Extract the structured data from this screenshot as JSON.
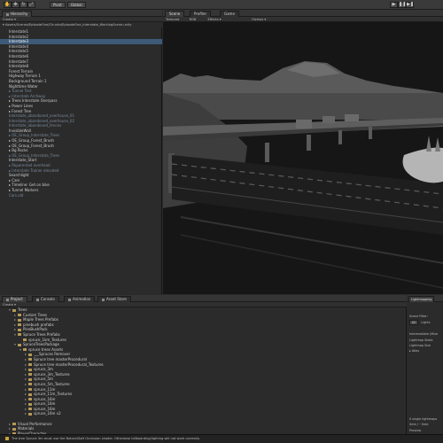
{
  "toolbar": {
    "transform_tools": [
      "✋",
      "✥",
      "↻",
      "⤢"
    ],
    "pivot_label": "Pivot",
    "global_label": "Global",
    "play_controls": [
      "▶",
      "❚❚",
      "▶❚"
    ]
  },
  "hierarchy": {
    "tab_label": "Hierarchy",
    "create_label": "Create ▾",
    "scene_path": "Assets/Scenes/EpisodeOne/Chunks/EpisodeOne_Interstate_WorkingScene.unity",
    "items": [
      {
        "label": "Interstate1",
        "selected": false,
        "dim": false
      },
      {
        "label": "Interstate2",
        "selected": false,
        "dim": false
      },
      {
        "label": "Interstate3",
        "selected": true,
        "dim": false
      },
      {
        "label": "Interstate4",
        "selected": false,
        "dim": false
      },
      {
        "label": "Interstate5",
        "selected": false,
        "dim": false
      },
      {
        "label": "Interstate6",
        "selected": false,
        "dim": false
      },
      {
        "label": "Interstate7",
        "selected": false,
        "dim": false
      },
      {
        "label": "Interstate8",
        "selected": false,
        "dim": false
      },
      {
        "label": "Forest Terrain",
        "selected": false,
        "dim": false
      },
      {
        "label": "Highway Terrain 1",
        "selected": false,
        "dim": false
      },
      {
        "label": "Background Terrain 1",
        "selected": false,
        "dim": false
      },
      {
        "label": "Nighttime Water",
        "selected": false,
        "dim": false
      },
      {
        "label": "▸ Tunnel Test",
        "selected": false,
        "dim": true
      },
      {
        "label": "▸ Interstate Archway",
        "selected": false,
        "dim": true
      },
      {
        "label": "▸ Trees Interstate Overpass",
        "selected": false,
        "dim": false
      },
      {
        "label": "▸ Power Lines",
        "selected": false,
        "dim": false
      },
      {
        "label": "▸ Forest Tree",
        "selected": false,
        "dim": false
      },
      {
        "label": "   Interstate_abandoned_overhouse_01",
        "selected": false,
        "dim": true
      },
      {
        "label": "   Interstate_abandoned_overhouse_02",
        "selected": false,
        "dim": true
      },
      {
        "label": "   Interstate_abandoned_fences",
        "selected": false,
        "dim": true
      },
      {
        "label": "   InvisibleWall",
        "selected": false,
        "dim": false
      },
      {
        "label": "▸ OE_Group_Interstate_Trees",
        "selected": false,
        "dim": true
      },
      {
        "label": "▸ OE_Group_Forest_Brush",
        "selected": false,
        "dim": false
      },
      {
        "label": "▸ OE_Group_Forest_Brush",
        "selected": false,
        "dim": false
      },
      {
        "label": "▸ Bg Rocks",
        "selected": false,
        "dim": false
      },
      {
        "label": "▸ OE_Group_Interstate_Trees",
        "selected": false,
        "dim": true
      },
      {
        "label": "   Interstate_Start",
        "selected": false,
        "dim": false
      },
      {
        "label": "▸ Reparented overhead",
        "selected": false,
        "dim": true
      },
      {
        "label": "▸ Interstate Trainer elevated",
        "selected": false,
        "dim": true
      },
      {
        "label": "   Searchlight",
        "selected": false,
        "dim": false
      },
      {
        "label": "▸ Cars",
        "selected": false,
        "dim": false
      },
      {
        "label": "▸ Timeline: Get on bike",
        "selected": false,
        "dim": false
      },
      {
        "label": "▸ Tunnel Markers",
        "selected": false,
        "dim": false
      },
      {
        "label": "   Cars.old",
        "selected": false,
        "dim": true
      }
    ]
  },
  "scene": {
    "tabs": [
      "Scene",
      "Profiler",
      "Game"
    ],
    "shading_mode": "Textured",
    "rgb_label": "RGB",
    "effects_label": "Effects ▾",
    "gizmos_label": "Gizmos ▾"
  },
  "project": {
    "tabs": [
      "Project",
      "Console",
      "Animation",
      "Asset Store"
    ],
    "create_label": "Create ▾",
    "items": [
      {
        "label": "Trees",
        "indent": 1,
        "arrow": "▾"
      },
      {
        "label": "Custom Trees",
        "indent": 2,
        "arrow": "▸"
      },
      {
        "label": "Maple Trees Prefabs",
        "indent": 2,
        "arrow": "▸"
      },
      {
        "label": "pinebush prefabs",
        "indent": 2,
        "arrow": "▸"
      },
      {
        "label": "PineBushPack",
        "indent": 2,
        "arrow": "▸"
      },
      {
        "label": "Spruce Trees Prefabs",
        "indent": 2,
        "arrow": "▾"
      },
      {
        "label": "spruce_1km_Textures",
        "indent": 3,
        "arrow": ""
      },
      {
        "label": "SpruceTreesPackage",
        "indent": 2,
        "arrow": "▾"
      },
      {
        "label": "spruce trees Assets",
        "indent": 3,
        "arrow": "▾"
      },
      {
        "label": "___Spruces Remover",
        "indent": 4,
        "arrow": "▸"
      },
      {
        "label": "Spruce tree masterProcedural",
        "indent": 4,
        "arrow": "▸"
      },
      {
        "label": "Spruce tree masterProcedural_Textures",
        "indent": 4,
        "arrow": "▸"
      },
      {
        "label": "spruce_3m",
        "indent": 4,
        "arrow": "▸"
      },
      {
        "label": "spruce_3m_Textures",
        "indent": 4,
        "arrow": "▸"
      },
      {
        "label": "spruce_5m",
        "indent": 4,
        "arrow": "▸"
      },
      {
        "label": "spruce_5m_Textures",
        "indent": 4,
        "arrow": "▸"
      },
      {
        "label": "spruce_11m",
        "indent": 4,
        "arrow": "▸"
      },
      {
        "label": "spruce_11m_Textures",
        "indent": 4,
        "arrow": "▸"
      },
      {
        "label": "spruce_16m",
        "indent": 4,
        "arrow": "▸"
      },
      {
        "label": "spruce_16m",
        "indent": 4,
        "arrow": "▸"
      },
      {
        "label": "spruce_16m",
        "indent": 4,
        "arrow": "▸"
      },
      {
        "label": "spruce_16m v2",
        "indent": 4,
        "arrow": "▸"
      },
      {
        "label": "",
        "indent": 0,
        "arrow": ""
      },
      {
        "label": "Visual Performance",
        "indent": 1,
        "arrow": "▸"
      },
      {
        "label": "Materials",
        "indent": 1,
        "arrow": "▸"
      },
      {
        "label": "PlayerCharacter",
        "indent": 1,
        "arrow": "▸"
      },
      {
        "label": "Props",
        "indent": 1,
        "arrow": "▸"
      },
      {
        "label": "Tools",
        "indent": 1,
        "arrow": "▸"
      }
    ]
  },
  "lightmapping": {
    "tab_label": "Lightmapping",
    "scene_filter": "Scene Filter:",
    "filter_all": "All",
    "filter_lights": "Lights",
    "mode_label": "Intermediate (Mixe",
    "lightmap_static": "Lightmap Static",
    "lightmap_size": "Lightmap Size",
    "atlas": "▸ Atlas",
    "footer1": "0 single lightmaps",
    "footer2": "0mb / ~0mb",
    "preview": "Preview"
  },
  "status": {
    "message": "The tree Spruce 3m must use the Nature/Soft Occlusion shader. Otherwise billboarding/lighting will not work correctly."
  }
}
